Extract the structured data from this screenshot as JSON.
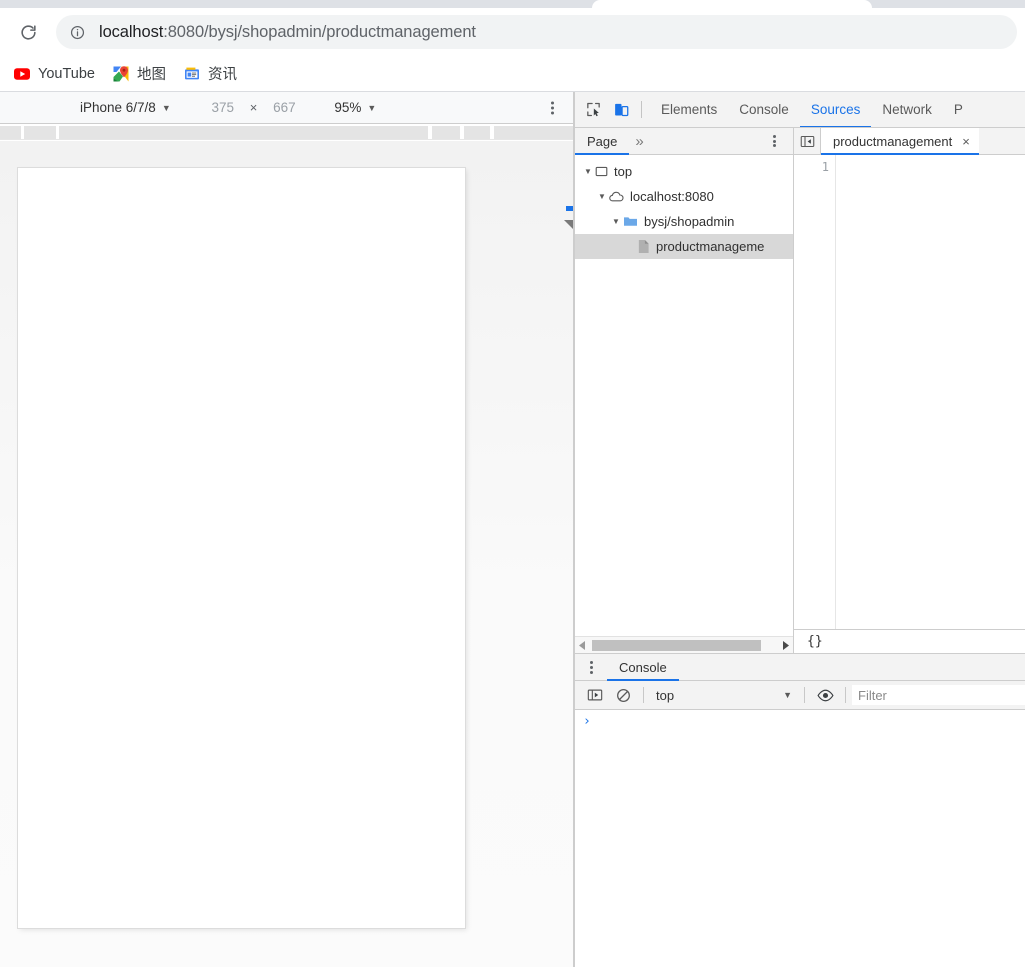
{
  "browser": {
    "reload_icon": "reload-icon",
    "site_info_icon": "info-circle-icon",
    "url_host": "localhost",
    "url_path": ":8080/bysj/shopadmin/productmanagement",
    "bookmarks": [
      {
        "label": "YouTube",
        "icon": "youtube-icon"
      },
      {
        "label": "地图",
        "icon": "google-maps-icon"
      },
      {
        "label": "资讯",
        "icon": "google-news-icon"
      }
    ]
  },
  "device_toolbar": {
    "device_name": "iPhone 6/7/8",
    "width": "375",
    "height": "667",
    "dimension_separator": "×",
    "zoom": "95%",
    "caret": "▼",
    "menu_icon": "more-vertical-icon"
  },
  "devtools": {
    "inspect_icon": "inspect-element-icon",
    "device_toolbar_icon": "device-toolbar-icon",
    "tabs": [
      {
        "label": "Elements",
        "active": false
      },
      {
        "label": "Console",
        "active": false
      },
      {
        "label": "Sources",
        "active": true
      },
      {
        "label": "Network",
        "active": false
      },
      {
        "label": "P",
        "active": false
      }
    ],
    "accent_color": "#1a73e8"
  },
  "navigator": {
    "tabs": [
      {
        "label": "Page",
        "active": true
      }
    ],
    "overflow_label": "»",
    "menu_icon": "more-vertical-icon",
    "tree": [
      {
        "label": "top",
        "icon": "frame-icon",
        "expander": "▼",
        "indent": 0,
        "selected": false
      },
      {
        "label": "localhost:8080",
        "icon": "cloud-icon",
        "expander": "▼",
        "indent": 1,
        "selected": false
      },
      {
        "label": "bysj/shopadmin",
        "icon": "folder-icon",
        "expander": "▼",
        "indent": 2,
        "selected": false
      },
      {
        "label": "productmanageme",
        "icon": "file-icon",
        "expander": "",
        "indent": 3,
        "selected": true
      }
    ],
    "scrollbar": {
      "left_arrow_icon": "scroll-left-arrow-icon",
      "right_arrow_icon": "scroll-right-arrow-icon"
    }
  },
  "editor": {
    "collapse_icon": "collapse-sidebar-icon",
    "tab_label": "productmanagement",
    "tab_close_icon": "×",
    "line_numbers": "1",
    "content": "",
    "pretty_print_label": "{}"
  },
  "drawer": {
    "menu_icon": "more-vertical-icon",
    "tabs": [
      {
        "label": "Console",
        "active": true
      }
    ],
    "toolbar": {
      "sidebar_icon": "console-sidebar-icon",
      "clear_icon": "clear-console-icon",
      "context": "top",
      "context_caret": "▼",
      "eye_icon": "live-expression-eye-icon",
      "filter_placeholder": "Filter",
      "filter_value": ""
    },
    "prompt_symbol": "›"
  }
}
